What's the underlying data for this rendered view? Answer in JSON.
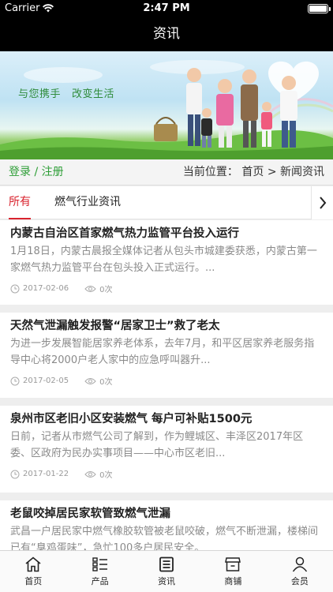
{
  "status_bar": {
    "carrier": "Carrier",
    "time": "2:47 PM"
  },
  "nav": {
    "title": "资讯"
  },
  "banner": {
    "slogan_left": "与您携手",
    "slogan_right": "改变生活"
  },
  "login": {
    "login_label": "登录",
    "separator": "/",
    "register_label": "注册"
  },
  "breadcrumb": {
    "prefix": "当前位置：",
    "home": "首页",
    "separator": ">",
    "current": "新闻资讯"
  },
  "tabs": [
    {
      "label": "所有",
      "active": true
    },
    {
      "label": "燃气行业资讯",
      "active": false
    }
  ],
  "articles": [
    {
      "title": "内蒙古自治区首家燃气热力监管平台投入运行",
      "summary": "1月18日，内蒙古晨报全媒体记者从包头市城建委获悉，内蒙古第一家燃气热力监管平台在包头投入正式运行。...",
      "date": "2017-02-06",
      "views": "0次"
    },
    {
      "title": "天然气泄漏触发报警“居家卫士”救了老太",
      "summary": "为进一步发展智能居家养老体系，去年7月，和平区居家养老服务指导中心将2000户老人家中的应急呼叫器升...",
      "date": "2017-02-05",
      "views": "0次"
    },
    {
      "title": "泉州市区老旧小区安装燃气 每户可补贴1500元",
      "summary": "日前，记者从市燃气公司了解到，作为鲤城区、丰泽区2017年区委、区政府为民办实事项目——中心市区老旧...",
      "date": "2017-01-22",
      "views": "0次"
    },
    {
      "title": "老鼠咬掉居民家软管致燃气泄漏",
      "summary": "武昌一户居民家中燃气橡胶软管被老鼠咬破，燃气不断泄漏，楼梯间已有“臭鸡蛋味”，急忙100多户居民安全。",
      "date": "",
      "views": ""
    }
  ],
  "tab_bar": [
    {
      "label": "首页",
      "icon": "home-icon"
    },
    {
      "label": "产品",
      "icon": "product-list-icon"
    },
    {
      "label": "资讯",
      "icon": "news-icon"
    },
    {
      "label": "商铺",
      "icon": "store-icon"
    },
    {
      "label": "会员",
      "icon": "member-icon"
    }
  ],
  "colors": {
    "accent": "#d9232e",
    "login_green": "#2e9e37",
    "bar": "#000000"
  }
}
